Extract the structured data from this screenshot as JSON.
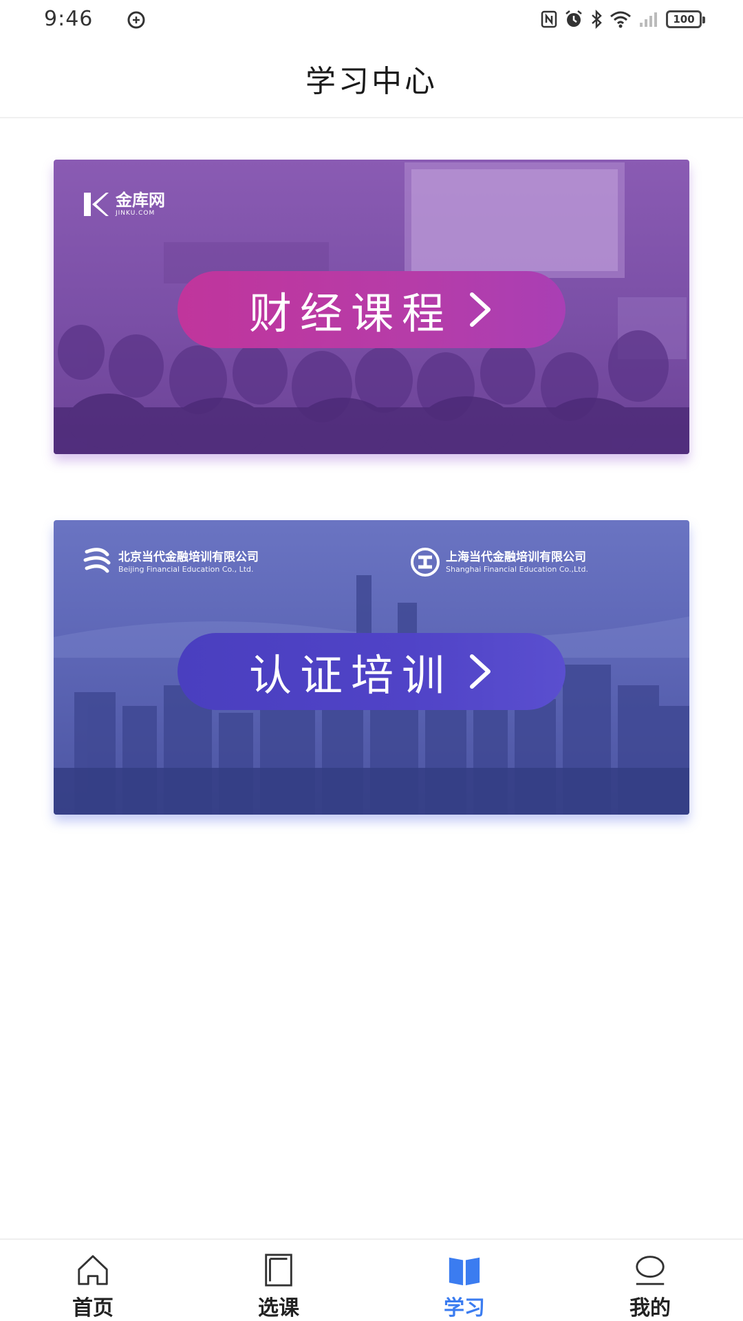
{
  "status_bar": {
    "time": "9:46",
    "left_icon": "sync-icon",
    "right_icons": [
      "nfc-icon",
      "alarm-icon",
      "bluetooth-icon",
      "wifi-icon",
      "signal-icon"
    ],
    "battery": "100"
  },
  "header": {
    "title": "学习中心"
  },
  "banners": [
    {
      "label": "财经课程",
      "brand_name": "金库网",
      "brand_sub": "JINKU.COM",
      "accent": "#b63ca8"
    },
    {
      "label": "认证培训",
      "org_left_name": "北京当代金融培训有限公司",
      "org_left_en": "Beijing Financial Education Co., Ltd.",
      "org_right_name": "上海当代金融培训有限公司",
      "org_right_en": "Shanghai Financial Education Co.,Ltd.",
      "accent": "#4a3fbf"
    }
  ],
  "bottom_nav": {
    "items": [
      {
        "label": "首页",
        "icon": "home-icon",
        "active": false
      },
      {
        "label": "选课",
        "icon": "book-outline-icon",
        "active": false
      },
      {
        "label": "学习",
        "icon": "open-book-icon",
        "active": true
      },
      {
        "label": "我的",
        "icon": "profile-icon",
        "active": false
      }
    ],
    "active_color": "#3b7cf0"
  }
}
